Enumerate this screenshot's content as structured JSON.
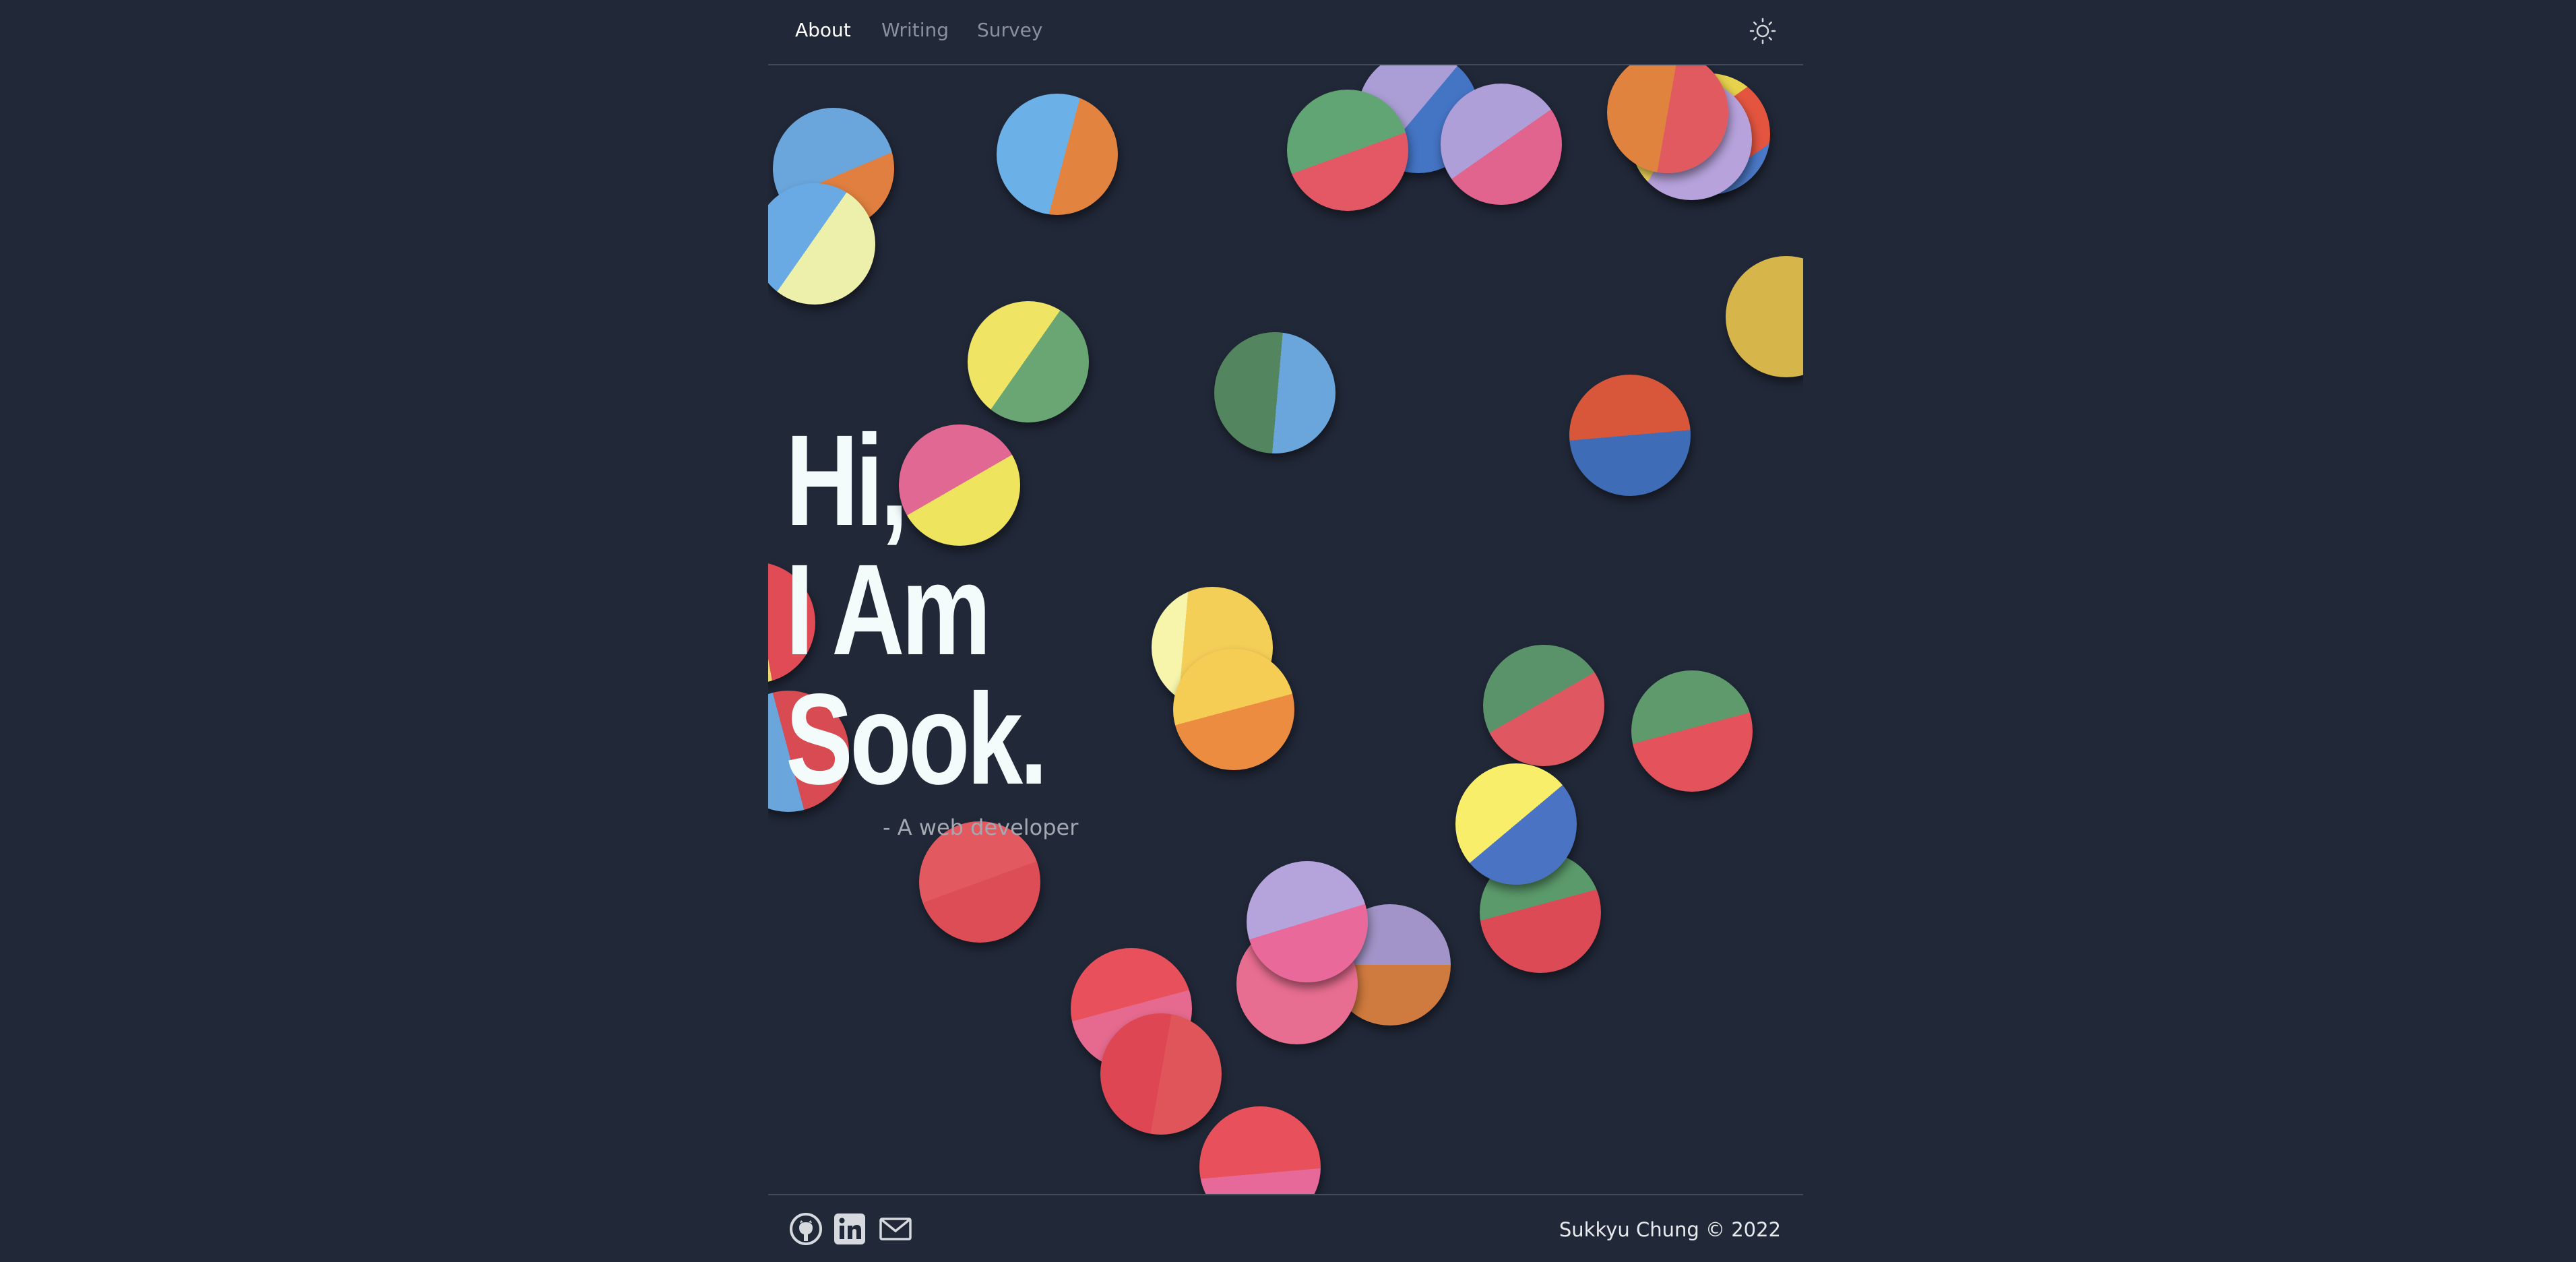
{
  "nav": {
    "links": [
      {
        "label": "About"
      },
      {
        "label": "Writing"
      },
      {
        "label": "Survey"
      }
    ]
  },
  "hero": {
    "line1": "Hi,",
    "line2": "I Am",
    "line3": "Sook.",
    "subtitle": "- A web developer"
  },
  "footer": {
    "copyright": "Sukkyu Chung © 2022"
  },
  "icons": {
    "theme": "sun-icon",
    "github": "github-icon",
    "linkedin": "linkedin-icon",
    "email": "mail-icon"
  },
  "colors": {
    "background": "#212838",
    "heading": "#f3fbfb",
    "nav_active": "#ffffff",
    "nav_inactive": "#8a909c",
    "divider": "#434a5a"
  }
}
